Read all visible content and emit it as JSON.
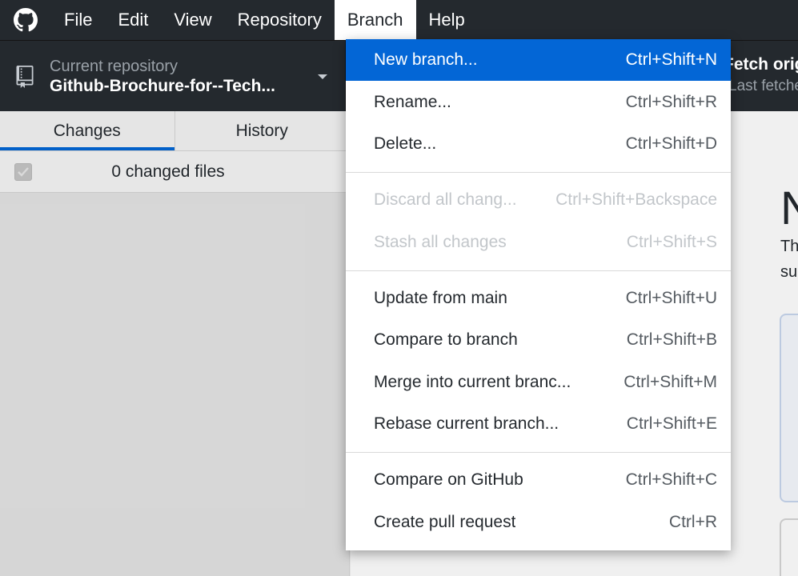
{
  "menubar": {
    "logo_icon": "github-octocat-icon",
    "items": [
      "File",
      "Edit",
      "View",
      "Repository",
      "Branch",
      "Help"
    ],
    "active": "Branch"
  },
  "toolbar": {
    "repo_caption": "Current repository",
    "repo_name": "Github-Brochure-for--Tech...",
    "fetch_title": "Fetch origin",
    "fetch_sub": "Last fetched"
  },
  "sidebar": {
    "tabs": [
      "Changes",
      "History"
    ],
    "selected_tab": "Changes",
    "changed_files": "0 changed files"
  },
  "content": {
    "big_letter": "N",
    "line1": "Th",
    "line2": "su"
  },
  "branch_menu": {
    "groups": [
      [
        {
          "label": "New branch...",
          "shortcut": "Ctrl+Shift+N",
          "state": "highlighted"
        },
        {
          "label": "Rename...",
          "shortcut": "Ctrl+Shift+R",
          "state": "enabled"
        },
        {
          "label": "Delete...",
          "shortcut": "Ctrl+Shift+D",
          "state": "enabled"
        }
      ],
      [
        {
          "label": "Discard all chang...",
          "shortcut": "Ctrl+Shift+Backspace",
          "state": "disabled"
        },
        {
          "label": "Stash all changes",
          "shortcut": "Ctrl+Shift+S",
          "state": "disabled"
        }
      ],
      [
        {
          "label": "Update from main",
          "shortcut": "Ctrl+Shift+U",
          "state": "enabled"
        },
        {
          "label": "Compare to branch",
          "shortcut": "Ctrl+Shift+B",
          "state": "enabled"
        },
        {
          "label": "Merge into current branc...",
          "shortcut": "Ctrl+Shift+M",
          "state": "enabled"
        },
        {
          "label": "Rebase current branch...",
          "shortcut": "Ctrl+Shift+E",
          "state": "enabled"
        }
      ],
      [
        {
          "label": "Compare on GitHub",
          "shortcut": "Ctrl+Shift+C",
          "state": "enabled"
        },
        {
          "label": "Create pull request",
          "shortcut": "Ctrl+R",
          "state": "enabled"
        }
      ]
    ]
  },
  "colors": {
    "chrome": "#24292e",
    "accent": "#0366d6"
  }
}
